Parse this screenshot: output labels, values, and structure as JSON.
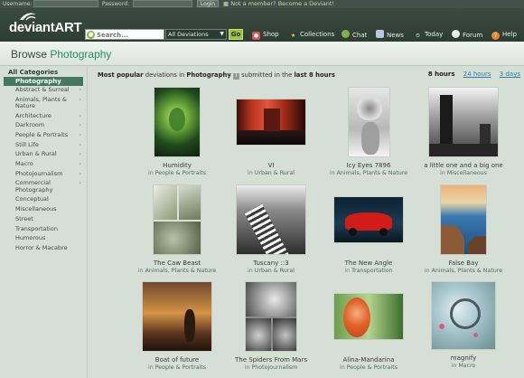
{
  "login_bar": {
    "username_label": "Username:",
    "password_label": "Password:",
    "login_button": "Login",
    "join_text": "Not a member? Become a Deviant!"
  },
  "header": {
    "logo_text": "deviantART",
    "search_placeholder": "Search...",
    "scope_selected": "All Deviations",
    "go_label": "Go",
    "nav": [
      {
        "icon": "shop-icon",
        "label": "Shop"
      },
      {
        "icon": "collections-icon",
        "label": "Collections"
      },
      {
        "icon": "chat-icon",
        "label": "Chat"
      },
      {
        "icon": "news-icon",
        "label": "News"
      },
      {
        "icon": "today-icon",
        "label": "Today"
      },
      {
        "icon": "forum-icon",
        "label": "Forum"
      },
      {
        "icon": "help-icon",
        "label": "Help"
      }
    ]
  },
  "title": {
    "prefix": "Browse",
    "category": "Photography"
  },
  "sidebar": {
    "all_label": "All Categories",
    "active_label": "Photography",
    "items": [
      {
        "label": "Abstract & Surreal",
        "has_children": true
      },
      {
        "label": "Animals, Plants & Nature",
        "has_children": true
      },
      {
        "label": "Architecture",
        "has_children": true
      },
      {
        "label": "Darkroom",
        "has_children": true
      },
      {
        "label": "People & Portraits",
        "has_children": true
      },
      {
        "label": "Still Life",
        "has_children": true
      },
      {
        "label": "Urban & Rural",
        "has_children": true
      },
      {
        "label": "Macro",
        "has_children": true
      },
      {
        "label": "Photojournalism",
        "has_children": true
      },
      {
        "label": "Commercial Photography",
        "has_children": true
      },
      {
        "label": "Conceptual",
        "has_children": false
      },
      {
        "label": "Miscellaneous",
        "has_children": false
      },
      {
        "label": "Street",
        "has_children": false
      },
      {
        "label": "Transportation",
        "has_children": false
      },
      {
        "label": "Humorous",
        "has_children": false
      },
      {
        "label": "Horror & Macabre",
        "has_children": false
      }
    ]
  },
  "summary": {
    "part1": "Most popular",
    "part2": " deviations in ",
    "part3": "Photography",
    "part4": " submitted in the ",
    "part5": "last 8 hours"
  },
  "time_filters": {
    "active": "8 hours",
    "links": [
      "24 hours",
      "3 days"
    ]
  },
  "deviations": [
    {
      "title": "Humidity",
      "category": "People & Portraits"
    },
    {
      "title": "VI",
      "category": "Urban & Rural"
    },
    {
      "title": "Icy Eyes 7896",
      "category": "Animals, Plants & Nature"
    },
    {
      "title": "a little one and a big one",
      "category": "Miscellaneous"
    },
    {
      "title": "The Caw Beast",
      "category": "Animals, Plants & Nature"
    },
    {
      "title": "Tuscany ::3",
      "category": "Urban & Rural"
    },
    {
      "title": "The New Angle",
      "category": "Transportation"
    },
    {
      "title": "False Bay",
      "category": "Animals, Plants & Nature"
    },
    {
      "title": "Boat of future",
      "category": "People & Portraits"
    },
    {
      "title": "The Spiders From Mars",
      "category": "Photojournalism"
    },
    {
      "title": "Alina-Mandarina",
      "category": "People & Portraits"
    },
    {
      "title": "magnify",
      "category": "Macro"
    }
  ],
  "colors": {
    "accent": "#2c8a67",
    "header": "#2d3d34",
    "sidebar_active": "#43795f",
    "link": "#2f7fa8"
  }
}
